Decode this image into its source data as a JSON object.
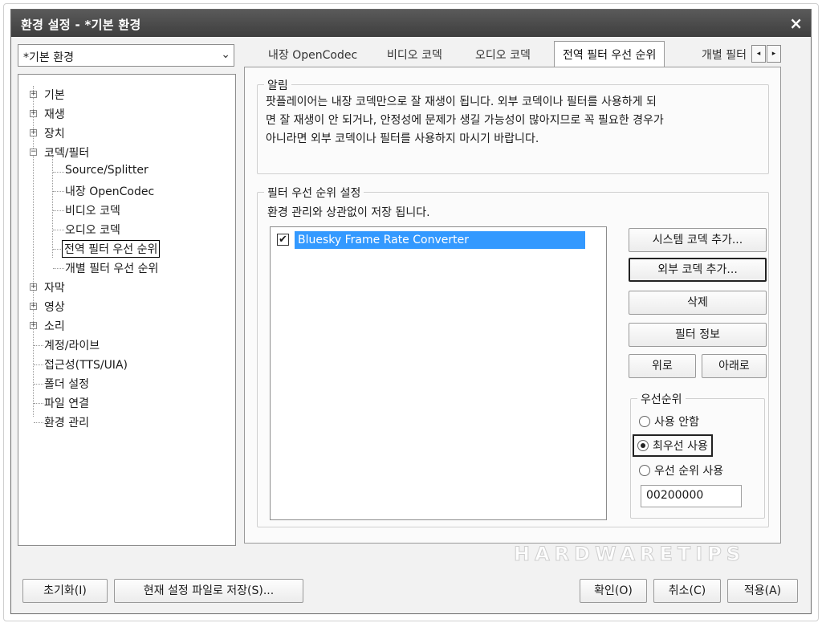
{
  "window": {
    "title": "환경 설정 - *기본 환경",
    "close_glyph": "×"
  },
  "profile_combo": {
    "value": "*기본 환경",
    "arrow": "⌄"
  },
  "tree": {
    "expand_glyph": "+",
    "collapse_glyph": "−",
    "items": [
      {
        "label": "기본"
      },
      {
        "label": "재생"
      },
      {
        "label": "장치"
      },
      {
        "label": "코덱/필터"
      },
      {
        "label": "Source/Splitter"
      },
      {
        "label": "내장 OpenCodec"
      },
      {
        "label": "비디오 코덱"
      },
      {
        "label": "오디오 코덱"
      },
      {
        "label": "전역 필터 우선 순위"
      },
      {
        "label": "개별 필터 우선 순위"
      },
      {
        "label": "자막"
      },
      {
        "label": "영상"
      },
      {
        "label": "소리"
      },
      {
        "label": "계정/라이브"
      },
      {
        "label": "접근성(TTS/UIA)"
      },
      {
        "label": "폴더 설정"
      },
      {
        "label": "파일 연결"
      },
      {
        "label": "환경 관리"
      }
    ]
  },
  "tabs": {
    "items": [
      "내장 OpenCodec",
      "비디오 코덱",
      "오디오 코덱",
      "전역 필터 우선 순위",
      "개별 필터"
    ],
    "prev": "◂",
    "next": "▸"
  },
  "notice": {
    "legend": "알림",
    "lines": [
      "팟플레이어는 내장 코덱만으로 잘 재생이 됩니다. 외부 코덱이나 필터를 사용하게 되",
      "면 잘 재생이 안 되거나, 안정성에 문제가 생길 가능성이 많아지므로 꼭 필요한 경우가",
      "아니라면 외부 코덱이나 필터를 사용하지 마시기 바랍니다."
    ]
  },
  "priority_settings": {
    "legend": "필터 우선 순위 설정",
    "subtitle": "환경 관리와 상관없이 저장 됩니다.",
    "filters": [
      {
        "name": "Bluesky Frame Rate Converter",
        "checked": true,
        "check_glyph": "✔"
      }
    ],
    "buttons": {
      "add_system": "시스템 코덱 추가...",
      "add_external": "외부 코덱 추가...",
      "delete": "삭제",
      "filter_info": "필터 정보",
      "up": "위로",
      "down": "아래로"
    },
    "priority": {
      "legend": "우선순위",
      "options": [
        "사용 안함",
        "최우선 사용",
        "우선 순위 사용"
      ],
      "selected": "최우선 사용",
      "value": "00200000"
    }
  },
  "footer": {
    "reset": "초기화(I)",
    "save_to_file": "현재 설정 파일로 저장(S)...",
    "ok": "확인(O)",
    "cancel": "취소(C)",
    "apply": "적용(A)"
  },
  "watermark": "HARDWARETIPS"
}
